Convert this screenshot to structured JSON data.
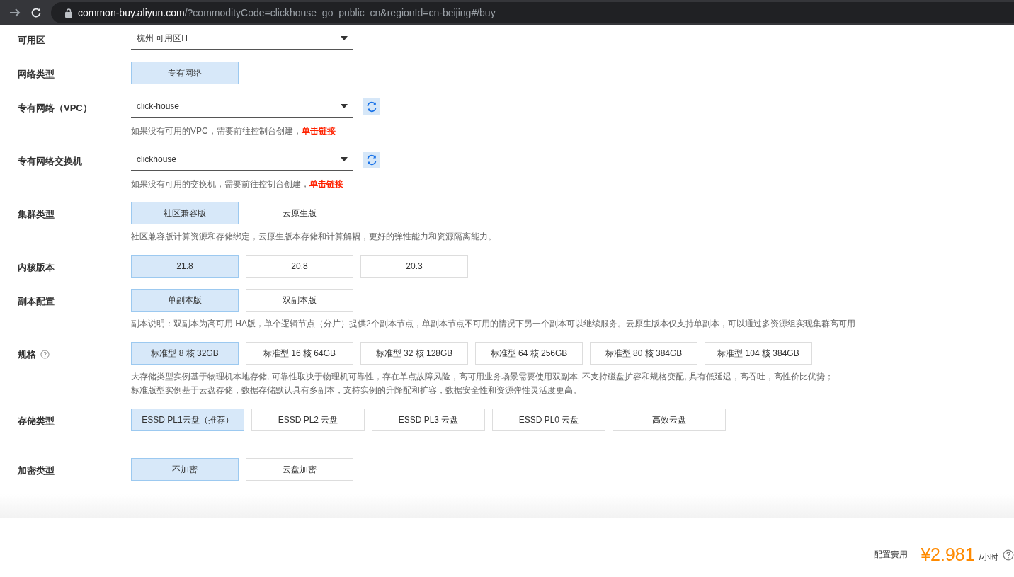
{
  "browser": {
    "host": "common-buy.aliyun.com",
    "path": "/?commodityCode=clickhouse_go_public_cn&regionId=cn-beijing#/buy"
  },
  "rows": [
    {
      "kind": "select",
      "label": "可用区",
      "value": "杭州 可用区H"
    },
    {
      "kind": "options",
      "label": "网络类型",
      "options": [
        {
          "label": "专有网络",
          "selected": true
        }
      ]
    },
    {
      "kind": "select",
      "label": "专有网络（VPC）",
      "value": "click-house",
      "refresh": true,
      "hint": "如果没有可用的VPC，需要前往控制台创建，",
      "link": "单击链接"
    },
    {
      "kind": "select",
      "label": "专有网络交换机",
      "value": "clickhouse",
      "refresh": true,
      "hint": "如果没有可用的交换机，需要前往控制台创建，",
      "link": "单击链接"
    },
    {
      "kind": "options",
      "label": "集群类型",
      "options": [
        {
          "label": "社区兼容版",
          "selected": true
        },
        {
          "label": "云原生版",
          "selected": false
        }
      ],
      "notes": [
        "社区兼容版计算资源和存储绑定，云原生版本存储和计算解耦，更好的弹性能力和资源隔离能力。"
      ]
    },
    {
      "kind": "options",
      "label": "内核版本",
      "options": [
        {
          "label": "21.8",
          "selected": true
        },
        {
          "label": "20.8",
          "selected": false
        },
        {
          "label": "20.3",
          "selected": false
        }
      ]
    },
    {
      "kind": "options",
      "label": "副本配置",
      "options": [
        {
          "label": "单副本版",
          "selected": true
        },
        {
          "label": "双副本版",
          "selected": false
        }
      ],
      "notes": [
        "副本说明：双副本为高可用 HA版，单个逻辑节点（分片）提供2个副本节点，单副本节点不可用的情况下另一个副本可以继续服务。云原生版本仅支持单副本，可以通过多资源组实现集群高可用"
      ]
    },
    {
      "kind": "options",
      "label": "规格",
      "help": true,
      "options": [
        {
          "label": "标准型 8 核 32GB",
          "selected": true
        },
        {
          "label": "标准型 16 核 64GB",
          "selected": false
        },
        {
          "label": "标准型 32 核 128GB",
          "selected": false
        },
        {
          "label": "标准型 64 核 256GB",
          "selected": false
        },
        {
          "label": "标准型 80 核 384GB",
          "selected": false
        },
        {
          "label": "标准型 104 核 384GB",
          "selected": false
        }
      ],
      "notes": [
        "大存储类型实例基于物理机本地存储, 可靠性取决于物理机可靠性，存在单点故障风险，高可用业务场景需要使用双副本, 不支持磁盘扩容和规格变配, 具有低延迟，高吞吐，高性价比优势；",
        "标准版型实例基于云盘存储，数据存储默认具有多副本，支持实例的升降配和扩容，数据安全性和资源弹性灵活度更高。"
      ]
    },
    {
      "kind": "options",
      "label": "存储类型",
      "wide": true,
      "options": [
        {
          "label": "ESSD PL1云盘（推荐）",
          "selected": true
        },
        {
          "label": "ESSD PL2 云盘",
          "selected": false
        },
        {
          "label": "ESSD PL3 云盘",
          "selected": false
        },
        {
          "label": "ESSD PL0 云盘",
          "selected": false
        },
        {
          "label": "高效云盘",
          "selected": false
        }
      ]
    },
    {
      "kind": "options",
      "label": "加密类型",
      "options": [
        {
          "label": "不加密",
          "selected": true
        },
        {
          "label": "云盘加密",
          "selected": false
        }
      ]
    }
  ],
  "footer": {
    "label": "配置费用",
    "price": "¥2.981",
    "unit": "/小时"
  }
}
